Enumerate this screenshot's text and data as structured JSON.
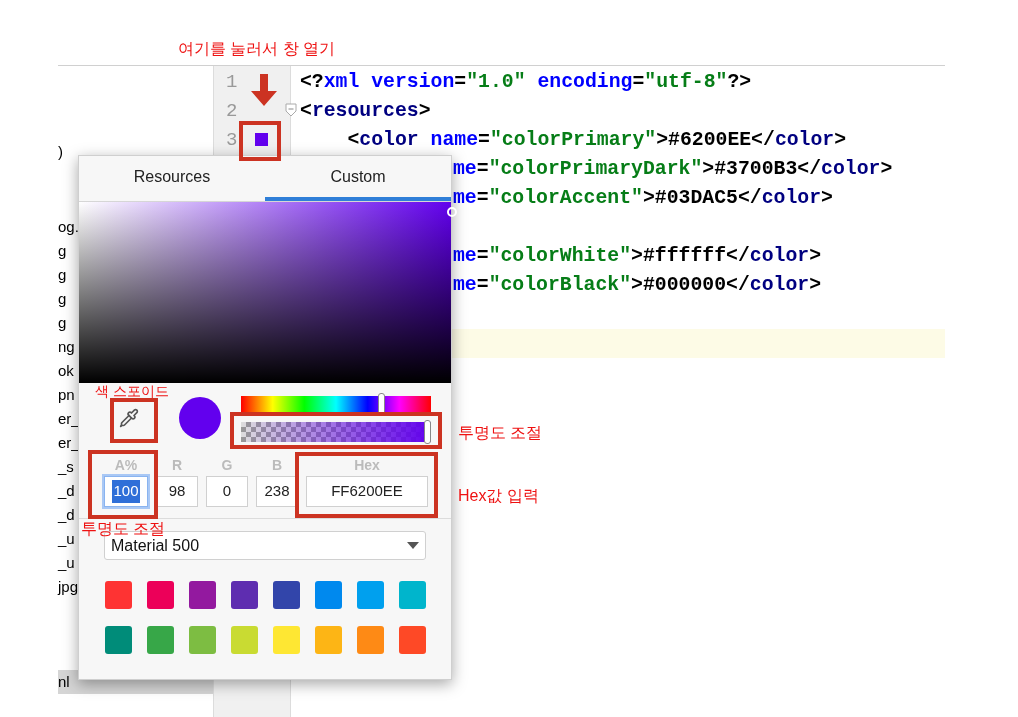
{
  "annotations": {
    "open_hint": "여기를 눌러서 창 열기",
    "eyedropper_hint": "색 스포이드",
    "alpha_slider_hint": "투명도 조절",
    "hex_hint": "Hex값 입력",
    "alpha_field_hint": "투명도 조절"
  },
  "project_tree": [
    {
      "text": ")",
      "selected": false
    },
    {
      "text": "og.",
      "selected": false
    },
    {
      "text": "g",
      "selected": false
    },
    {
      "text": "g",
      "selected": false
    },
    {
      "text": "g",
      "selected": false
    },
    {
      "text": "g",
      "selected": false
    },
    {
      "text": "ng",
      "selected": false
    },
    {
      "text": "ok",
      "selected": false
    },
    {
      "text": "pn",
      "selected": false
    },
    {
      "text": "er_",
      "selected": false
    },
    {
      "text": "er_",
      "selected": false
    },
    {
      "text": "_s",
      "selected": false
    },
    {
      "text": "_d",
      "selected": false
    },
    {
      "text": "_d",
      "selected": false
    },
    {
      "text": "_u",
      "selected": false
    },
    {
      "text": "_u",
      "selected": false
    },
    {
      "text": "jpg",
      "selected": false
    },
    {
      "text": "nl",
      "selected": true
    }
  ],
  "line_numbers": [
    "1",
    "2",
    "3"
  ],
  "code_lines": [
    {
      "covered": false,
      "segments": [
        {
          "kind": "plain",
          "text": "<?"
        },
        {
          "kind": "attr",
          "text": "xml version"
        },
        {
          "kind": "plain",
          "text": "="
        },
        {
          "kind": "value",
          "text": "\"1.0\""
        },
        {
          "kind": "attr",
          "text": " encoding"
        },
        {
          "kind": "plain",
          "text": "="
        },
        {
          "kind": "value",
          "text": "\"utf-8\""
        },
        {
          "kind": "plain",
          "text": "?>"
        }
      ]
    },
    {
      "covered": false,
      "segments": [
        {
          "kind": "plain",
          "text": "<"
        },
        {
          "kind": "tag",
          "text": "resources"
        },
        {
          "kind": "plain",
          "text": ">"
        }
      ]
    },
    {
      "covered": false,
      "segments": [
        {
          "kind": "plain",
          "text": "    <"
        },
        {
          "kind": "tag",
          "text": "color"
        },
        {
          "kind": "attr",
          "text": " name"
        },
        {
          "kind": "plain",
          "text": "="
        },
        {
          "kind": "value",
          "text": "\"colorPrimary\""
        },
        {
          "kind": "plain",
          "text": ">#6200EE</"
        },
        {
          "kind": "tag",
          "text": "color"
        },
        {
          "kind": "plain",
          "text": ">"
        }
      ]
    },
    {
      "covered": true,
      "segments": [
        {
          "kind": "attr",
          "text": "me"
        },
        {
          "kind": "plain",
          "text": "="
        },
        {
          "kind": "value",
          "text": "\"colorPrimaryDark\""
        },
        {
          "kind": "plain",
          "text": ">#3700B3</"
        },
        {
          "kind": "tag",
          "text": "color"
        },
        {
          "kind": "plain",
          "text": ">"
        }
      ]
    },
    {
      "covered": true,
      "segments": [
        {
          "kind": "attr",
          "text": "me"
        },
        {
          "kind": "plain",
          "text": "="
        },
        {
          "kind": "value",
          "text": "\"colorAccent\""
        },
        {
          "kind": "plain",
          "text": ">#03DAC5</"
        },
        {
          "kind": "tag",
          "text": "color"
        },
        {
          "kind": "plain",
          "text": ">"
        }
      ]
    },
    {
      "covered": true,
      "blank_line_before": true,
      "segments": [
        {
          "kind": "attr",
          "text": "me"
        },
        {
          "kind": "plain",
          "text": "="
        },
        {
          "kind": "value",
          "text": "\"colorWhite\""
        },
        {
          "kind": "plain",
          "text": ">#ffffff</"
        },
        {
          "kind": "tag",
          "text": "color"
        },
        {
          "kind": "plain",
          "text": ">"
        }
      ]
    },
    {
      "covered": true,
      "segments": [
        {
          "kind": "attr",
          "text": "me"
        },
        {
          "kind": "plain",
          "text": "="
        },
        {
          "kind": "value",
          "text": "\"colorBlack\""
        },
        {
          "kind": "plain",
          "text": ">#000000</"
        },
        {
          "kind": "tag",
          "text": "color"
        },
        {
          "kind": "plain",
          "text": ">"
        }
      ]
    }
  ],
  "current_line": {
    "highlighted": true
  },
  "gutter_swatch": {
    "color": "#6200ee"
  },
  "color_picker": {
    "tabs": [
      {
        "label": "Resources",
        "selected": false
      },
      {
        "label": "Custom",
        "selected": true
      }
    ],
    "preview": {
      "color": "#6200ee"
    },
    "hue_slider": {
      "level": 0.74
    },
    "alpha_slider": {
      "level": 1
    },
    "fields": [
      {
        "label": "A%",
        "value": "100",
        "text_selected": true
      },
      {
        "label": "R",
        "value": "98",
        "text_selected": false
      },
      {
        "label": "G",
        "value": "0",
        "text_selected": false
      },
      {
        "label": "B",
        "value": "238",
        "text_selected": false
      },
      {
        "label": "Hex",
        "value": "FF6200EE",
        "text_selected": false
      }
    ],
    "palette": {
      "value": "Material 500"
    },
    "swatches": [
      {
        "color": "#fe3333"
      },
      {
        "color": "#ec0059"
      },
      {
        "color": "#93199f"
      },
      {
        "color": "#5e2db0"
      },
      {
        "color": "#3245aa"
      },
      {
        "color": "#0089ee"
      },
      {
        "color": "#00a0ee"
      },
      {
        "color": "#00b5cc"
      },
      {
        "color": "#008c79"
      },
      {
        "color": "#37a748"
      },
      {
        "color": "#7dbd42"
      },
      {
        "color": "#c9db32"
      },
      {
        "color": "#fee733"
      },
      {
        "color": "#fdb515"
      },
      {
        "color": "#fe8a15"
      },
      {
        "color": "#fe4926"
      }
    ]
  }
}
